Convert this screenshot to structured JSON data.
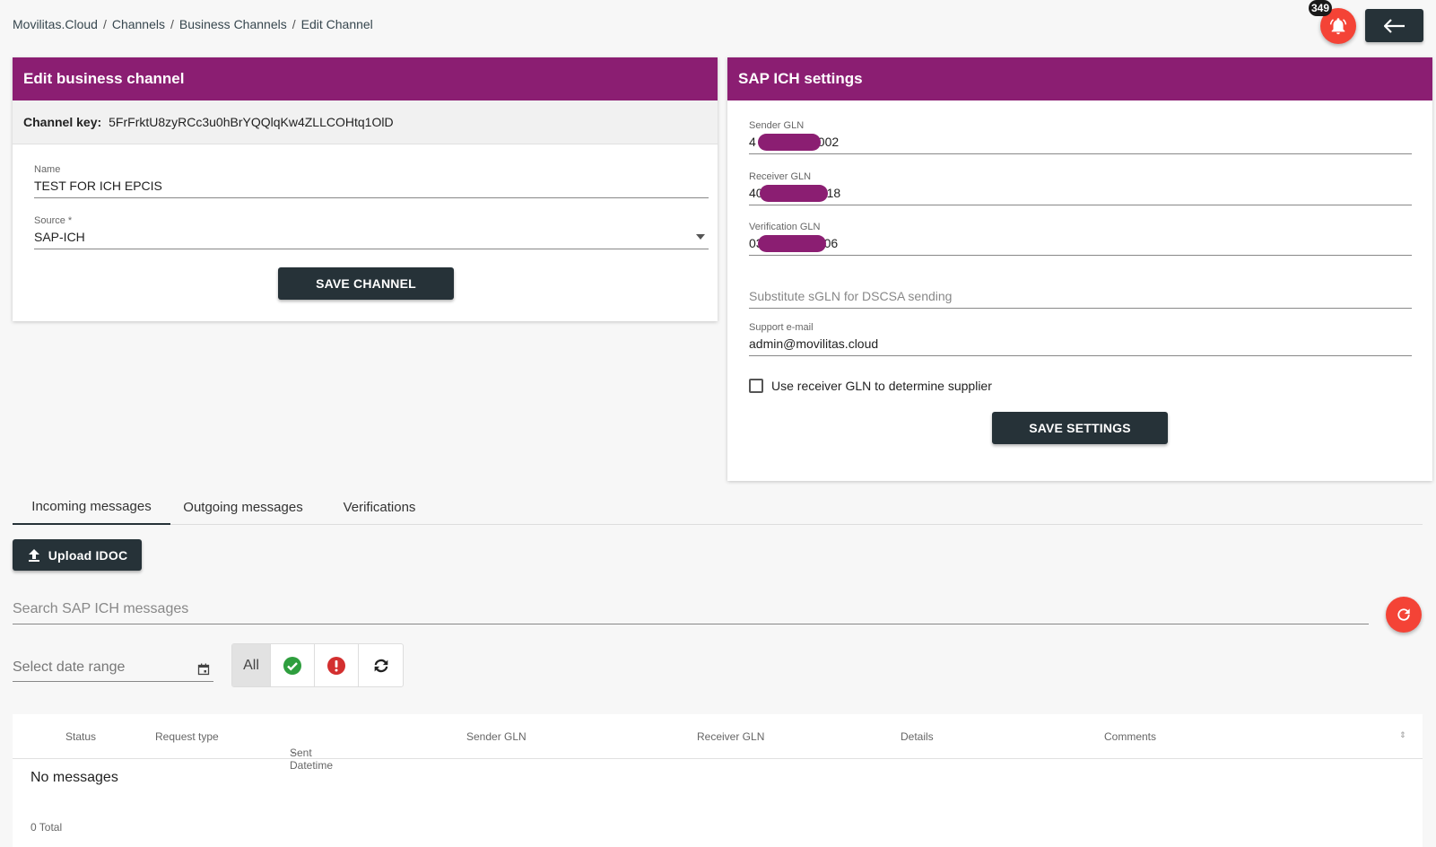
{
  "breadcrumb": [
    "Movilitas.Cloud",
    "Channels",
    "Business Channels",
    "Edit Channel"
  ],
  "notifications": {
    "count": "349"
  },
  "edit_card": {
    "title": "Edit business channel",
    "channel_key_label": "Channel key:",
    "channel_key": "5FrFrktU8zyRCc3u0hBrYQQlqKw4ZLLCOHtq1OlD",
    "name_label": "Name",
    "name_value": "TEST FOR ICH EPCIS",
    "source_label": "Source *",
    "source_value": "SAP-ICH",
    "save_label": "SAVE CHANNEL"
  },
  "settings_card": {
    "title": "SAP ICH settings",
    "sender_label": "Sender GLN",
    "sender_prefix": "4",
    "sender_suffix": "002",
    "receiver_label": "Receiver GLN",
    "receiver_prefix": "40",
    "receiver_suffix": "18",
    "verification_label": "Verification GLN",
    "verification_prefix": "03",
    "verification_suffix": "06",
    "substitute_placeholder": "Substitute sGLN for DSCSA sending",
    "support_label": "Support e-mail",
    "support_value": "admin@movilitas.cloud",
    "checkbox_label": "Use receiver GLN to determine supplier",
    "save_label": "SAVE SETTINGS"
  },
  "tabs": [
    "Incoming messages",
    "Outgoing messages",
    "Verifications"
  ],
  "upload_label": "Upload IDOC",
  "search_placeholder": "Search SAP ICH messages",
  "date_placeholder": "Select date range",
  "filter_all": "All",
  "table": {
    "columns": [
      "Status",
      "Request type",
      "Sent Datetime",
      "Sender GLN",
      "Receiver GLN",
      "Details",
      "Comments"
    ],
    "empty": "No messages",
    "total": "0 Total"
  },
  "colors": {
    "header": "#8b1e72",
    "dark": "#263238",
    "accent": "#f44336"
  }
}
